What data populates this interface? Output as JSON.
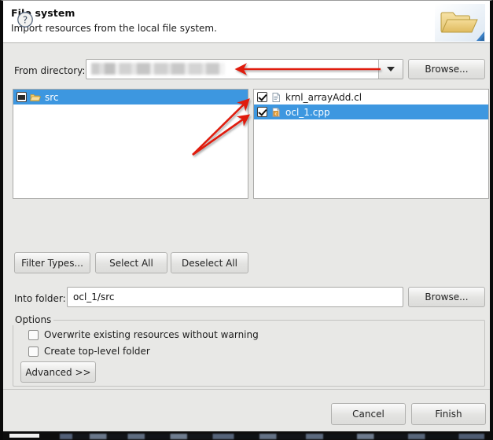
{
  "window": {
    "title": "File system",
    "subtitle": "Import resources from the local file system.",
    "header_icon": "open-folder-icon"
  },
  "from_directory": {
    "label": "From directory:",
    "value": "",
    "value_redacted": true,
    "dropdown_icon": "chevron-down-icon",
    "browse_label": "Browse..."
  },
  "tree_panel": {
    "items": [
      {
        "label": "src",
        "icon": "open-folder-icon",
        "checkbox": "partial",
        "selected": true
      }
    ]
  },
  "file_panel": {
    "items": [
      {
        "label": "krnl_arrayAdd.cl",
        "icon": "file-document-icon",
        "checkbox": "checked",
        "selected": false
      },
      {
        "label": "ocl_1.cpp",
        "icon": "file-cpp-icon",
        "checkbox": "checked",
        "selected": true
      }
    ]
  },
  "selection_buttons": {
    "filter_types": "Filter Types...",
    "select_all": "Select All",
    "deselect_all": "Deselect All"
  },
  "into_folder": {
    "label": "Into folder:",
    "value": "ocl_1/src",
    "browse_label": "Browse..."
  },
  "options": {
    "legend": "Options",
    "checkboxes": [
      {
        "label": "Overwrite existing resources without warning",
        "checked": false
      },
      {
        "label": "Create top-level folder",
        "checked": false
      }
    ],
    "advanced_label": "Advanced >>"
  },
  "footer": {
    "help_icon": "help-question-icon",
    "cancel_label": "Cancel",
    "finish_label": "Finish"
  },
  "annotations": {
    "color": "#e01b10",
    "arrows": [
      {
        "name": "arrow-to-from-directory",
        "from": [
          480,
          87
        ],
        "to": [
          293,
          87
        ]
      },
      {
        "name": "arrow-to-file-checkbox-1",
        "from": [
          241,
          196
        ],
        "to": [
          316,
          124
        ]
      },
      {
        "name": "arrow-to-file-checkbox-2",
        "from": [
          241,
          196
        ],
        "to": [
          316,
          144
        ]
      }
    ]
  },
  "colors": {
    "selection_blue": "#3d97e0",
    "dialog_bg": "#e8e8e6",
    "panel_bg": "#ffffff",
    "annotation_red": "#e01b10"
  }
}
